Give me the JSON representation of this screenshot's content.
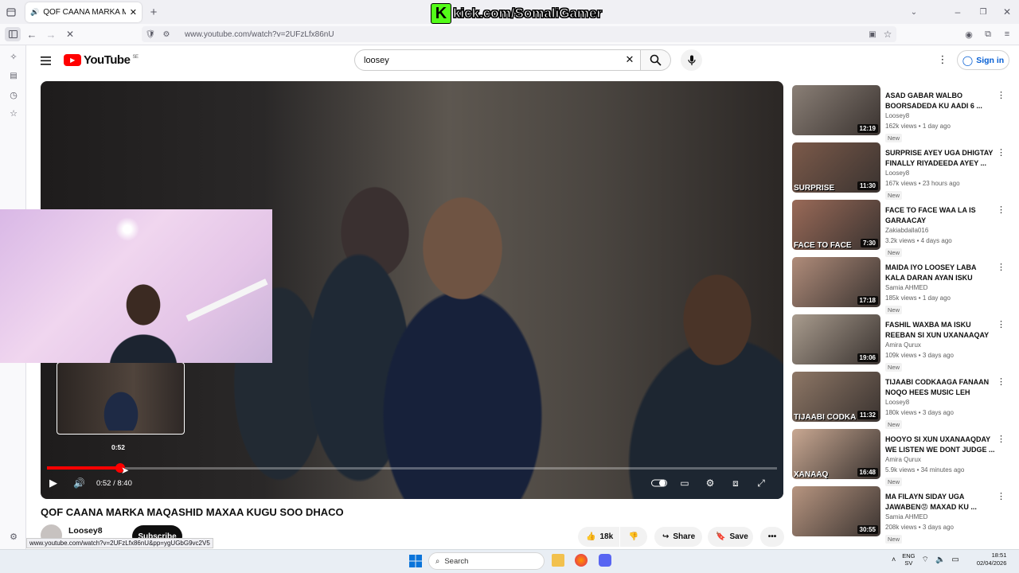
{
  "browser": {
    "tab_title": "QOF CAANA MARKA MAQASHI",
    "url": "www.youtube.com/watch?v=2UFzLfx86nU",
    "status_url": "www.youtube.com/watch?v=2UFzLfx86nU&pp=ygUGbG9vc2V5"
  },
  "overlay": {
    "kick_text": "kick.com/SomaliGamer",
    "kick_letter": "K"
  },
  "youtube": {
    "logo_text": "YouTube",
    "region": "SE",
    "search_value": "loosey",
    "signin_label": "Sign in"
  },
  "player": {
    "hover_time": "0:52",
    "time_display": "0:52 / 8:40",
    "progress": 0.1
  },
  "video": {
    "title": "QOF CAANA MARKA MAQASHID MAXAA KUGU SOO DHACO",
    "channel": "Loosey8",
    "subscribe_label": "Subscribe",
    "likes": "18k",
    "share_label": "Share",
    "save_label": "Save"
  },
  "recommendations": [
    {
      "title": "ASAD GABAR WALBO BOORSADEDA KU AADI 6 ...",
      "channel": "Loosey8",
      "meta": "162k views • 1 day ago",
      "badge": "New",
      "duration": "12:19",
      "overlay": "",
      "color": "#8a7f76"
    },
    {
      "title": "SURPRISE AYEY UGA DHIGTAY FINALLY RIYADEEDA AYEY ...",
      "channel": "Loosey8",
      "meta": "167k views • 23 hours ago",
      "badge": "New",
      "duration": "11:30",
      "overlay": "SURPRISE",
      "color": "#7c5a4a"
    },
    {
      "title": "FACE TO FACE WAA LA IS GARAACAY",
      "channel": "Zakiabdalla016",
      "meta": "3.2k views • 4 days ago",
      "badge": "New",
      "duration": "7:30",
      "overlay": "FACE TO FACE",
      "color": "#9a6a58"
    },
    {
      "title": "MAIDA IYO LOOSEY LABA KALA DARAN AYAN ISKU BALAMIYA...",
      "channel": "Samia AHMED",
      "meta": "185k views • 1 day ago",
      "badge": "New",
      "duration": "17:18",
      "overlay": "",
      "color": "#b08c7a"
    },
    {
      "title": "FASHIL WAXBA MA ISKU REEBAN SI XUN UXANAAQAY ...",
      "channel": "Amira Qurux",
      "meta": "109k views • 3 days ago",
      "badge": "New",
      "duration": "19:06",
      "overlay": "",
      "color": "#a99c8e"
    },
    {
      "title": "TIJAABI CODKAAGA FANAAN NOQO HEES MUSIC LEH AYEY...",
      "channel": "Loosey8",
      "meta": "180k views • 3 days ago",
      "badge": "New",
      "duration": "11:32",
      "overlay": "TIJAABI CODKA",
      "color": "#8e7766"
    },
    {
      "title": "HOOYO SI XUN UXANAAQDAY WE LISTEN WE DONT JUDGE ...",
      "channel": "Amira Qurux",
      "meta": "5.9k views • 34 minutes ago",
      "badge": "New",
      "duration": "16:48",
      "overlay": "XANAAQ",
      "color": "#c9a892"
    },
    {
      "title": "MA FILAYN SIDAY UGA JAWABEN😡 MAXAD KU ...",
      "channel": "Samia AHMED",
      "meta": "208k views • 3 days ago",
      "badge": "New",
      "duration": "30:55",
      "overlay": "",
      "color": "#b79580"
    }
  ],
  "taskbar": {
    "search_placeholder": "Search",
    "lang_top": "ENG",
    "lang_bottom": "SV",
    "time": "18:51",
    "date": "02/04/2026"
  }
}
